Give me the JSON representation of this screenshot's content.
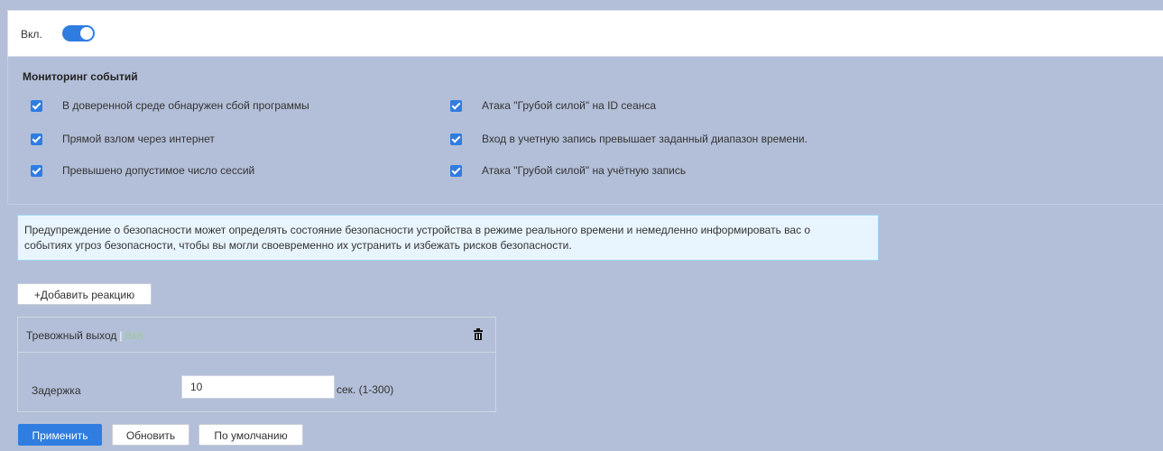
{
  "toggle": {
    "label": "Вкл.",
    "state": "on",
    "accent": "#2f7de1"
  },
  "monitoring": {
    "title": "Мониторинг событий",
    "events": [
      {
        "label": "В доверенной среде обнаружен сбой программы",
        "checked": true
      },
      {
        "label": "Прямой взлом через интернет",
        "checked": true
      },
      {
        "label": "Превышено допустимое число сессий",
        "checked": true
      },
      {
        "label": "Атака \"Грубой силой\" на ID сеанса",
        "checked": true
      },
      {
        "label": "Вход в учетную запись превышает заданный диапазон времени.",
        "checked": true
      },
      {
        "label": "Атака \"Грубой силой\" на учётную запись",
        "checked": true
      }
    ]
  },
  "info": {
    "line1": "Предупреждение о безопасности может определять состояние безопасности устройства в режиме реального времени и немедленно информировать вас о",
    "line2": "событиях угроз безопасности, чтобы вы могли своевременно их устранить и избежать рисков безопасности."
  },
  "add_reaction_label": "+Добавить реакцию",
  "reaction": {
    "title": "Тревожный выход",
    "separator": "|",
    "status": "Вкл.",
    "trash_icon": "trash-icon",
    "delay_label": "Задержка",
    "delay_value": "10",
    "delay_unit": "сек. (1-300)"
  },
  "actions": {
    "apply": "Применить",
    "refresh": "Обновить",
    "default": "По умолчанию"
  }
}
